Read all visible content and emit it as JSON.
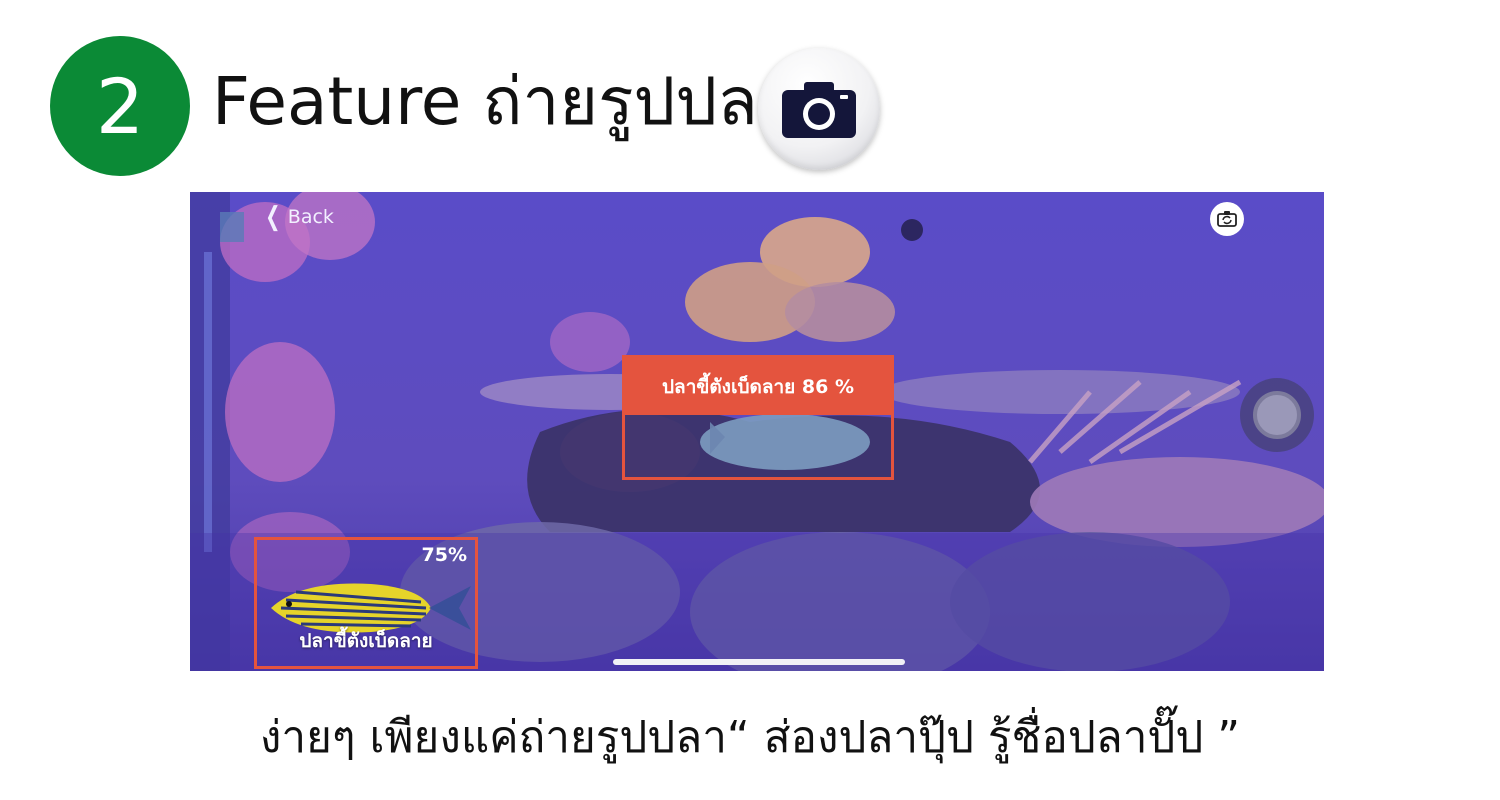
{
  "header": {
    "step_number": "2",
    "title": "Feature ถ่ายรูปปลา",
    "app_icon": "camera-icon"
  },
  "screen": {
    "back_label": "Back",
    "back_icon": "chevron-left-icon",
    "flip_icon": "flip-camera-icon",
    "detection": {
      "label": "ปลาขี้ตังเบ็ดลาย 86 %",
      "box_color": "#e4543e"
    },
    "result_card": {
      "percent": "75%",
      "name": "ปลาขี้ตังเบ็ดลาย"
    },
    "shutter_icon": "shutter-icon"
  },
  "caption": "ง่ายๆ เพียงแค่ถ่ายรูปปลา“ ส่องปลาปุ๊ป รู้ชื่อปลาปั๊ป ”",
  "colors": {
    "badge": "#0b8a36",
    "accent": "#e4543e",
    "underwater": "#5c4bc0"
  }
}
